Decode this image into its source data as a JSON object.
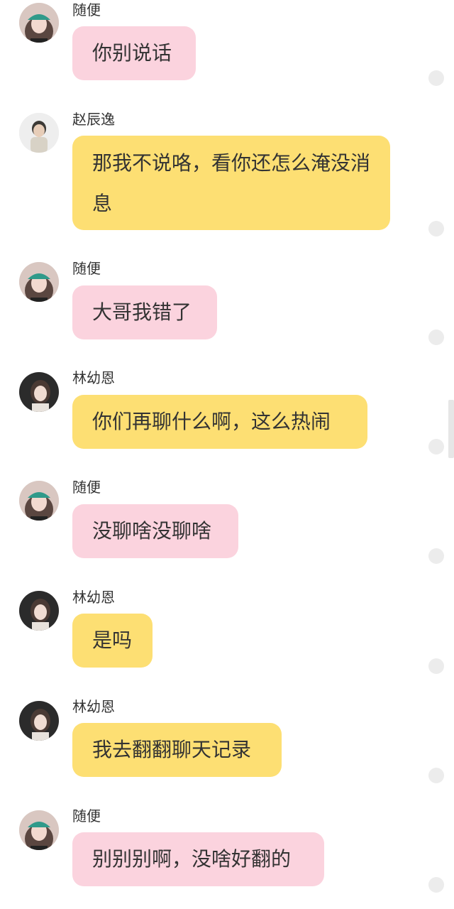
{
  "colors": {
    "pink_bubble": "#fbd3de",
    "yellow_bubble": "#fddf73",
    "text": "#333333",
    "read_dot": "#ececec"
  },
  "messages": [
    {
      "sender": "随便",
      "text": "你别说话",
      "bubble": "pink",
      "avatar": "girl-cap-avatar"
    },
    {
      "sender": "赵辰逸",
      "text": "那我不说咯，看你还怎么淹没消息",
      "bubble": "yellow",
      "avatar": "boy-avatar"
    },
    {
      "sender": "随便",
      "text": "大哥我错了",
      "bubble": "pink",
      "avatar": "girl-cap-avatar"
    },
    {
      "sender": "林幼恩",
      "text": "你们再聊什么啊，这么热闹",
      "bubble": "yellow",
      "avatar": "girl-dark-avatar"
    },
    {
      "sender": "随便",
      "text": "没聊啥没聊啥",
      "bubble": "pink",
      "avatar": "girl-cap-avatar"
    },
    {
      "sender": "林幼恩",
      "text": "是吗",
      "bubble": "yellow",
      "avatar": "girl-dark-avatar"
    },
    {
      "sender": "林幼恩",
      "text": "我去翻翻聊天记录",
      "bubble": "yellow",
      "avatar": "girl-dark-avatar"
    },
    {
      "sender": "随便",
      "text": "别别别啊，没啥好翻的",
      "bubble": "pink",
      "avatar": "girl-cap-avatar"
    }
  ]
}
